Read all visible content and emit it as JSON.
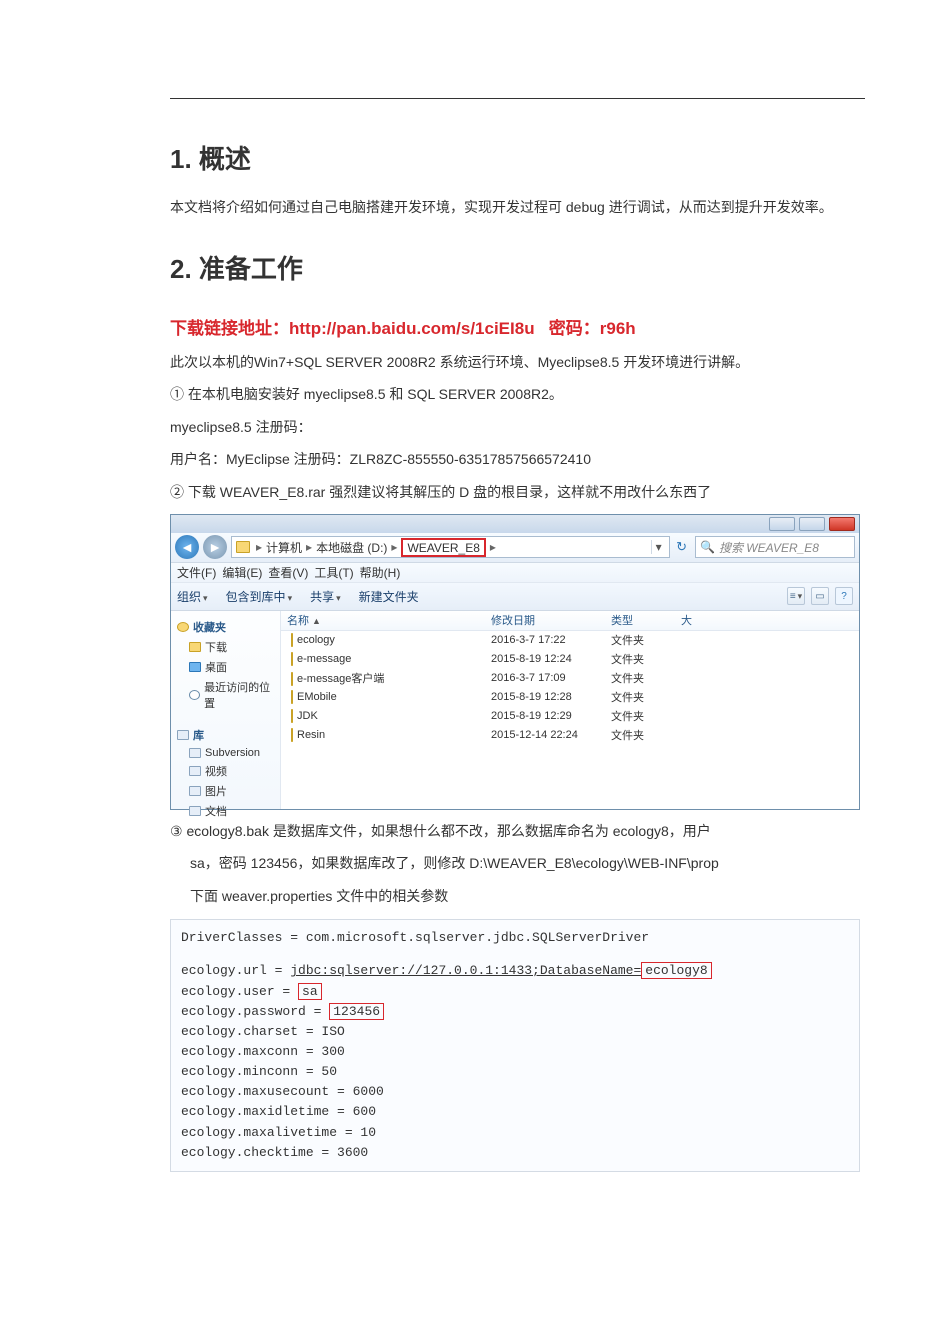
{
  "section1": {
    "heading": "1. 概述",
    "body": "本文档将介绍如何通过自己电脑搭建开发环境，实现开发过程可 debug 进行调试，从而达到提升开发效率。"
  },
  "section2": {
    "heading": "2. 准备工作",
    "download_label": "下载链接地址：",
    "download_url": "http://pan.baidu.com/s/1ciEI8u",
    "download_pwlabel": "密码：",
    "download_pw": "r96h",
    "intro": "此次以本机的Win7+SQL SERVER 2008R2 系统运行环境、Myeclipse8.5 开发环境进行讲解。",
    "step1": "① 在本机电脑安装好 myeclipse8.5 和 SQL SERVER 2008R2。",
    "line_reg": "myeclipse8.5 注册码：",
    "line_user": "用户名：MyEclipse 注册码：ZLR8ZC-855550-63517857566572410",
    "step2": "② 下载 WEAVER_E8.rar 强烈建议将其解压的 D 盘的根目录，这样就不用改什么东西了",
    "step3a": "③ ecology8.bak 是数据库文件，如果想什么都不改，那么数据库命名为 ecology8，用户",
    "step3b": "sa，密码 123456，如果数据库改了，则修改 D:\\WEAVER_E8\\ecology\\WEB-INF\\prop",
    "step3c": "下面 weaver.properties 文件中的相关参数"
  },
  "explorer": {
    "breadcrumb": {
      "seg1": "计算机",
      "seg2": "本地磁盘 (D:)",
      "seg3": "WEAVER_E8",
      "arrow": "▸"
    },
    "refresh_hint": "↻",
    "search_placeholder": "搜索 WEAVER_E8",
    "menubar": {
      "file": "文件(F)",
      "edit": "编辑(E)",
      "view": "查看(V)",
      "tools": "工具(T)",
      "help": "帮助(H)"
    },
    "toolbar": {
      "org": "组织",
      "lib": "包含到库中",
      "share": "共享",
      "newf": "新建文件夹"
    },
    "sidebar": {
      "fav": "收藏夹",
      "fav1": "下载",
      "fav2": "桌面",
      "fav3": "最近访问的位置",
      "libs": "库",
      "l1": "Subversion",
      "l2": "视频",
      "l3": "图片",
      "l4": "文档",
      "l5trim": "(…)"
    },
    "columns": {
      "name": "名称",
      "date": "修改日期",
      "type": "类型",
      "size": "大"
    },
    "files": [
      {
        "name": "ecology",
        "date": "2016-3-7 17:22",
        "type": "文件夹"
      },
      {
        "name": "e-message",
        "date": "2015-8-19 12:24",
        "type": "文件夹"
      },
      {
        "name": "e-message客户端",
        "date": "2016-3-7 17:09",
        "type": "文件夹"
      },
      {
        "name": "EMobile",
        "date": "2015-8-19 12:28",
        "type": "文件夹"
      },
      {
        "name": "JDK",
        "date": "2015-8-19 12:29",
        "type": "文件夹"
      },
      {
        "name": "Resin",
        "date": "2015-12-14 22:24",
        "type": "文件夹"
      }
    ]
  },
  "props": {
    "l1": "DriverClasses = com.microsoft.sqlserver.jdbc.SQLServerDriver",
    "l2a": "ecology.url = ",
    "l2b": "jdbc:sqlserver://127.0.0.1:1433;DatabaseName=",
    "l2c": "ecology8",
    "l3a": "ecology.user = ",
    "l3b": "sa",
    "l4a": "ecology.password = ",
    "l4b": "123456",
    "l5": "ecology.charset = ISO",
    "l6": "ecology.maxconn = 300",
    "l7": "ecology.minconn = 50",
    "l8": "ecology.maxusecount = 6000",
    "l9": "ecology.maxidletime = 600",
    "l10": "ecology.maxalivetime = 10",
    "l11": "ecology.checktime = 3600"
  }
}
